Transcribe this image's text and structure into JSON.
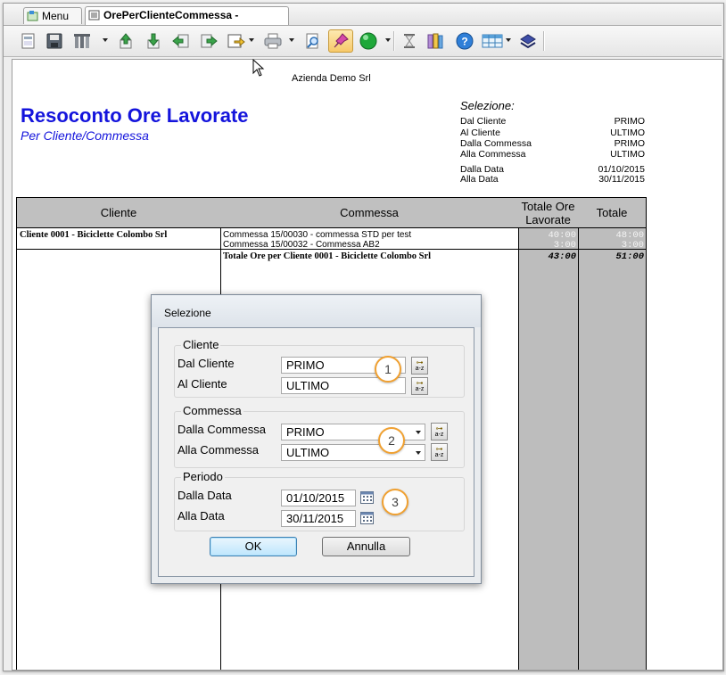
{
  "tabs": [
    {
      "label": "Menu"
    },
    {
      "label": "OrePerClienteCommessa - Standard"
    }
  ],
  "report": {
    "company": "Azienda Demo Srl",
    "title": "Resoconto Ore Lavorate",
    "subtitle": "Per Cliente/Commessa",
    "selection": {
      "heading": "Selezione:",
      "rows": [
        {
          "label": "Dal Cliente",
          "value": "PRIMO"
        },
        {
          "label": "Al Cliente",
          "value": "ULTIMO"
        },
        {
          "label": "Dalla Commessa",
          "value": "PRIMO"
        },
        {
          "label": "Alla Commessa",
          "value": "ULTIMO"
        },
        {
          "label": "Dalla Data",
          "value": "01/10/2015"
        },
        {
          "label": "Alla Data",
          "value": "30/11/2015"
        }
      ]
    },
    "columns": {
      "cliente": "Cliente",
      "commessa": "Commessa",
      "ore": "Totale Ore Lavorate",
      "totale": "Totale"
    },
    "rows": [
      {
        "cliente": "Cliente 0001 - Biciclette Colombo Srl",
        "commessa": "Commessa 15/00030 -  commessa STD per test",
        "ore": "40:00",
        "totale": "48:00"
      },
      {
        "cliente": "",
        "commessa": "Commessa 15/00032 -  Commessa AB2",
        "ore": "3:00",
        "totale": "3:00"
      }
    ],
    "total_row": {
      "label": "Totale Ore per Cliente 0001 - Biciclette Colombo Srl",
      "ore": "43:00",
      "totale": "51:00"
    }
  },
  "dialog": {
    "title": "Selezione",
    "groups": {
      "cliente": {
        "label": "Cliente",
        "from_label": "Dal Cliente",
        "from_value": "PRIMO",
        "to_label": "Al Cliente",
        "to_value": "ULTIMO"
      },
      "commessa": {
        "label": "Commessa",
        "from_label": "Dalla Commessa",
        "from_value": "PRIMO",
        "to_label": "Alla Commessa",
        "to_value": "ULTIMO"
      },
      "periodo": {
        "label": "Periodo",
        "from_label": "Dalla Data",
        "from_value": "01/10/2015",
        "to_label": "Alla Data",
        "to_value": "30/11/2015"
      }
    },
    "lookup_button_text": "a-z",
    "badges": [
      "1",
      "2",
      "3"
    ],
    "ok_label": "OK",
    "cancel_label": "Annulla"
  },
  "icons": [
    "menu-tab-icon",
    "report-tab-icon",
    "page-setup-icon",
    "save-icon",
    "tools-icon",
    "export-up-icon",
    "import-down-icon",
    "prev-page-icon",
    "next-page-icon",
    "export-file-icon",
    "print-icon",
    "preview-icon",
    "pin-icon",
    "run-icon",
    "hourglass-icon",
    "library-icon",
    "help-icon",
    "table-icon",
    "designer-icon"
  ],
  "colors": {
    "title": "#1414dc",
    "header_fill": "#c0c0c0",
    "total_column_fill": "#bdbdbd",
    "badge_border": "#f0a030",
    "ok_button": "#bee6fd"
  }
}
